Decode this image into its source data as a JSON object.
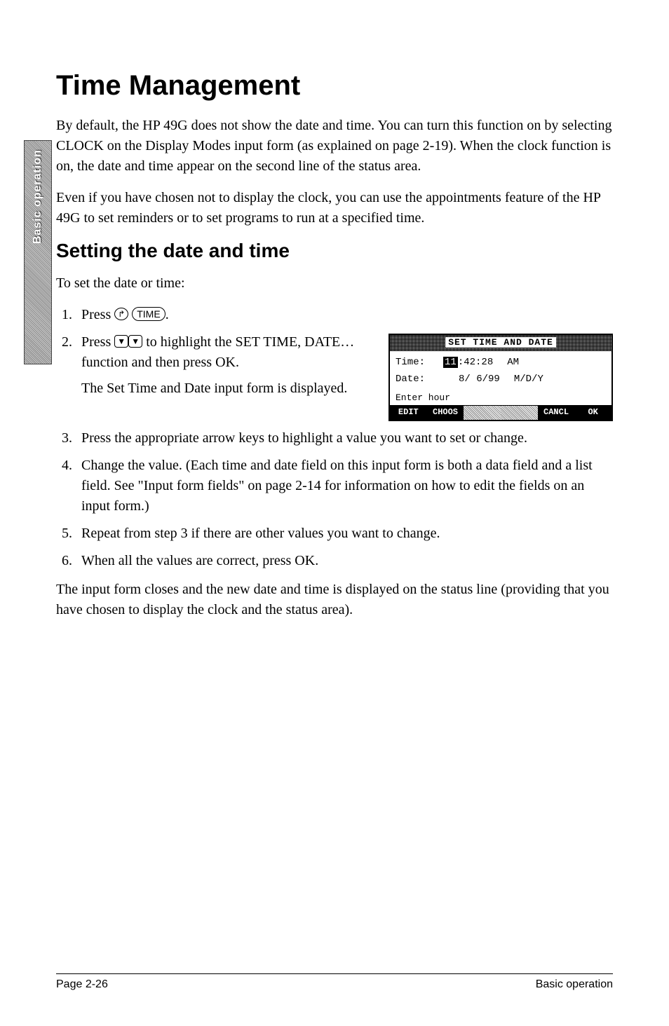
{
  "sideTab": "Basic operation",
  "title": "Time Management",
  "para1": "By default, the HP 49G does not show the date and time. You can turn this function on by selecting CLOCK on the Display Modes input form (as explained on page 2-19). When the clock function is on, the date and time appear on the second line of the status area.",
  "para2": "Even if you have chosen not to display the clock, you can use the appointments feature of the HP 49G to set reminders or to set programs to run at a specified time.",
  "subhead": "Setting the date and time",
  "para3": "To set the date or time:",
  "steps": {
    "s1_a": "Press ",
    "s1_key1": "↱",
    "s1_key2": "TIME",
    "s1_b": ".",
    "s2_a": "Press ",
    "s2_key": "▼",
    "s2_b": " to highlight the ",
    "s2_sc": "SET TIME, DATE…",
    "s2_c": " function and then press ",
    "s2_ok": "OK",
    "s2_d": ".",
    "s2_sub": "The Set Time and Date input form is displayed.",
    "s3": "Press the appropriate arrow keys to high­light a value you want to set or change.",
    "s4": "Change the value. (Each time and date field on this input form is both a data field and a list field. See \"Input form fields\" on page 2-14 for infor­mation on how to edit the fields on an input form.)",
    "s5": "Repeat from step 3 if there are other values you want to change.",
    "s6_a": "When all the values are correct, press ",
    "s6_ok": "OK",
    "s6_b": "."
  },
  "para4": "The input form closes and the new date and time is displayed on the status line (providing that you have chosen to display the clock and the status area).",
  "calc": {
    "title": "SET TIME AND DATE",
    "timeLabel": "Time:",
    "hh": "11",
    "mm": ":42",
    "ss": ":28",
    "ampm": "AM",
    "dateLabel": "Date:",
    "d1": "8",
    "d2": "/ 6",
    "d3": "/99",
    "fmt": "M/D/Y",
    "hint": "Enter hour",
    "menu": {
      "m1": "EDIT",
      "m2": "CHOOS",
      "m3": "",
      "m4": "",
      "m5": "CANCL",
      "m6": "OK"
    }
  },
  "footer": {
    "left": "Page 2-26",
    "right": "Basic operation"
  }
}
